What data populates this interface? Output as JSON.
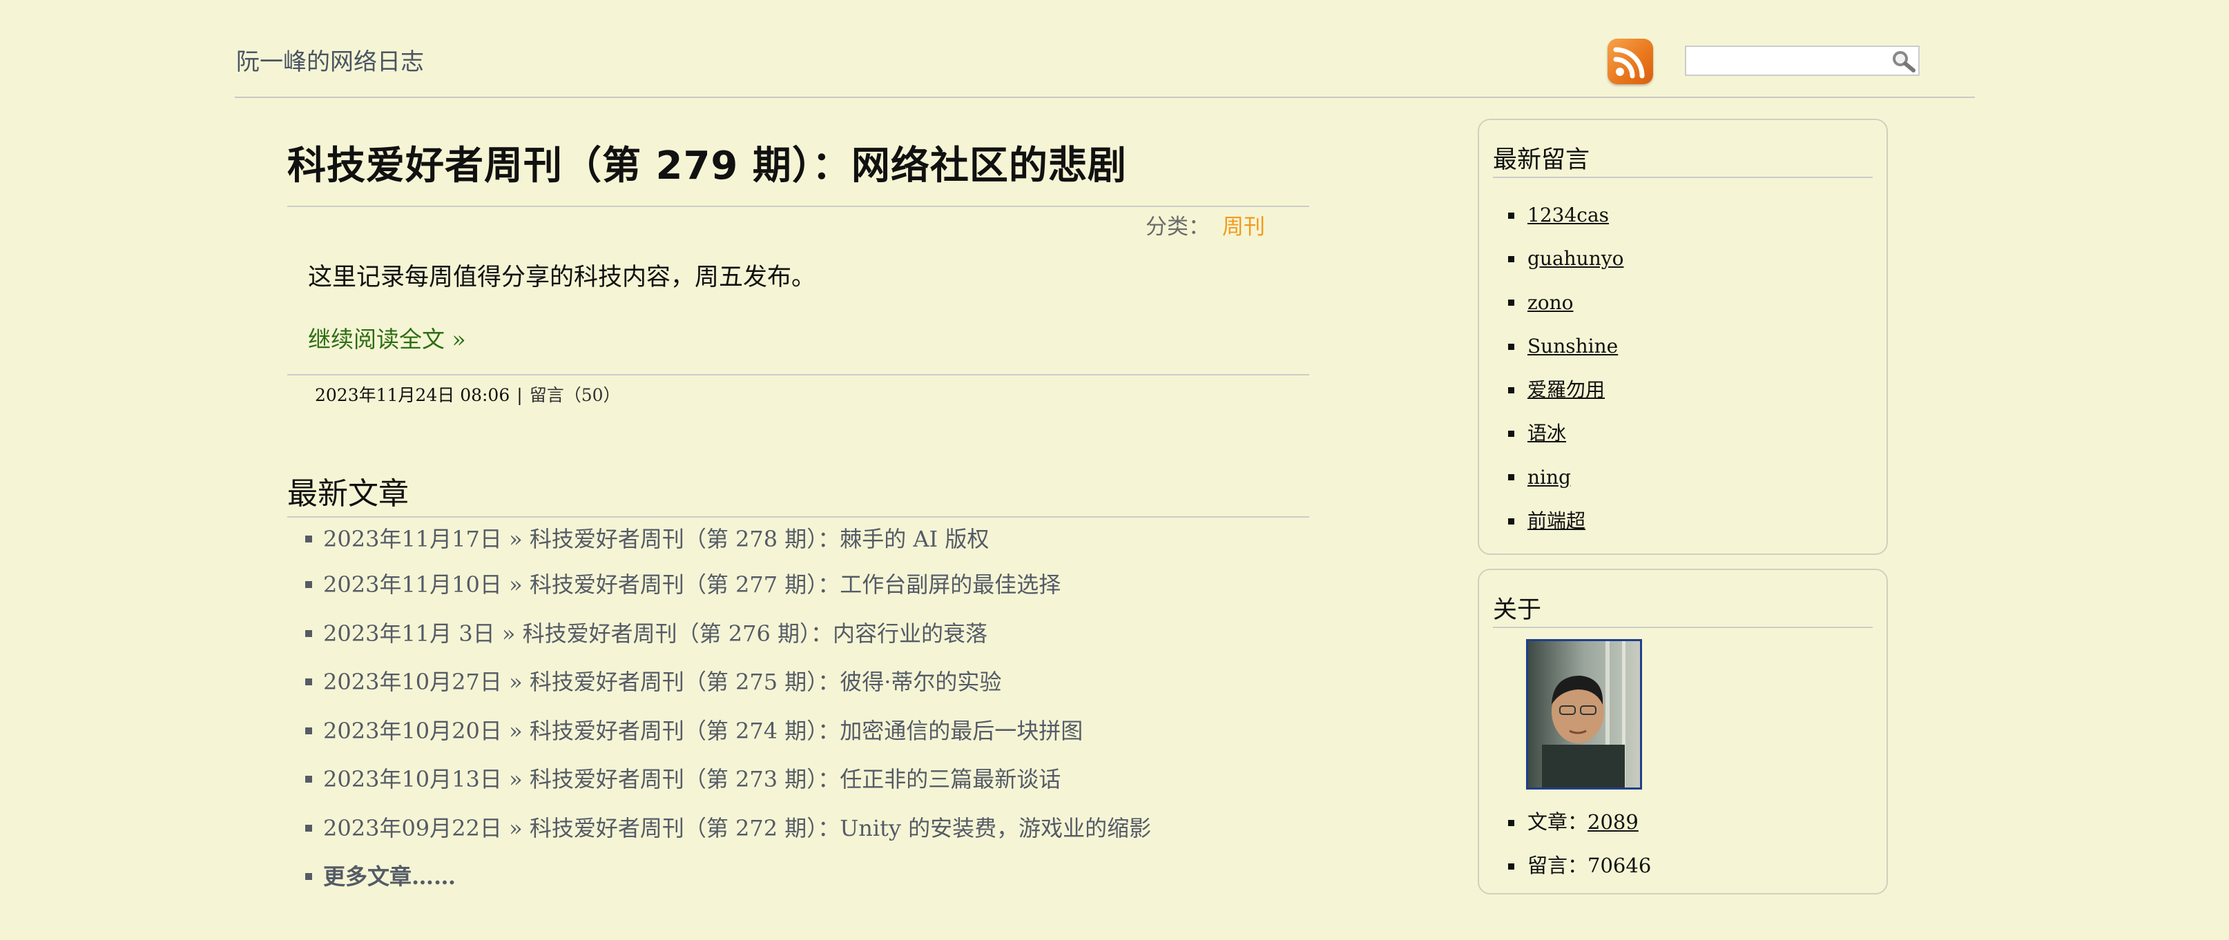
{
  "header": {
    "site_title": "阮一峰的网络日志",
    "rss_icon": "rss-feed-icon",
    "search": {
      "value": "",
      "placeholder": "",
      "button_icon": "magnifier-icon"
    }
  },
  "article": {
    "title": "科技爱好者周刊（第 279 期）：网络社区的悲剧",
    "category_label": "分类：",
    "category": "周刊",
    "summary": "这里记录每周值得分享的科技内容，周五发布。",
    "read_more": "继续阅读全文 »",
    "date": "2023年11月24日 08:06",
    "separator": "|",
    "comments": "留言（50）"
  },
  "latest": {
    "title": "最新文章",
    "items": [
      {
        "date": "2023年11月17日",
        "sep": " » ",
        "title": "科技爱好者周刊（第 278 期）：棘手的 AI 版权"
      },
      {
        "date": "2023年11月10日",
        "sep": " » ",
        "title": "科技爱好者周刊（第 277 期）：工作台副屏的最佳选择"
      },
      {
        "date": "2023年11月 3日",
        "sep": " » ",
        "title": "科技爱好者周刊（第 276 期）：内容行业的衰落"
      },
      {
        "date": "2023年10月27日",
        "sep": " » ",
        "title": "科技爱好者周刊（第 275 期）：彼得·蒂尔的实验"
      },
      {
        "date": "2023年10月20日",
        "sep": " » ",
        "title": "科技爱好者周刊（第 274 期）：加密通信的最后一块拼图"
      },
      {
        "date": "2023年10月13日",
        "sep": " » ",
        "title": "科技爱好者周刊（第 273 期）：任正非的三篇最新谈话"
      },
      {
        "date": "2023年09月22日",
        "sep": " » ",
        "title": "科技爱好者周刊（第 272 期）：Unity 的安装费，游戏业的缩影"
      }
    ],
    "more": "更多文章……"
  },
  "sidebar": {
    "comments_title": "最新留言",
    "comments": [
      "1234cas",
      "guahunyo",
      "zono",
      "Sunshine",
      "爱羅勿用",
      "语冰",
      "ning",
      "前端超"
    ],
    "about_title": "关于",
    "avatar": "author-avatar",
    "stats": [
      {
        "label": "文章：",
        "value": "2089",
        "link": true
      },
      {
        "label": "留言：",
        "value": "70646",
        "link": false
      }
    ]
  },
  "colors": {
    "background": "#f5f5d5",
    "link_gray": "#555b66",
    "category_orange": "#f29a1f",
    "read_more_green": "#2f6e14",
    "avatar_border": "#1f3f8a"
  }
}
